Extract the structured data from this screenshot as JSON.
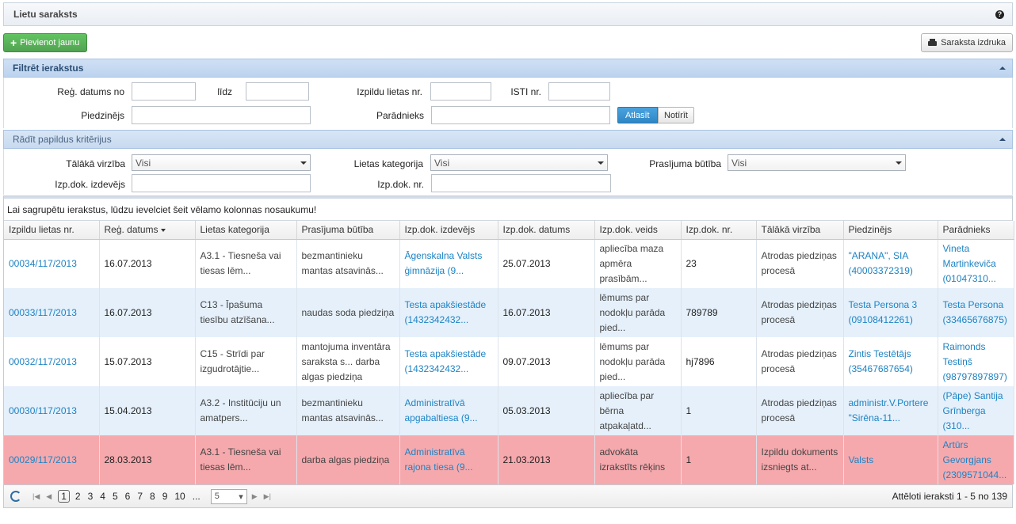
{
  "header": {
    "title": "Lietu saraksts",
    "help_icon": "?"
  },
  "toolbar": {
    "add_label": "Pievienot jaunu",
    "print_label": "Saraksta izdruka"
  },
  "filter": {
    "title": "Filtrēt ierakstus",
    "reg_from_label": "Reģ. datums no",
    "reg_to_label": "līdz",
    "case_no_label": "Izpildu lietas nr.",
    "isti_label": "ISTI nr.",
    "claimant_label": "Piedzinējs",
    "debtor_label": "Parādnieks",
    "search_label": "Atlasīt",
    "clear_label": "Notīrīt"
  },
  "extra": {
    "title": "Rādīt papildus kritērijus",
    "direction_label": "Tālākā virzība",
    "direction_value": "Visi",
    "category_label": "Lietas kategorija",
    "category_value": "Visi",
    "claim_label": "Prasījuma būtība",
    "claim_value": "Visi",
    "issuer_label": "Izp.dok. izdevējs",
    "docno_label": "Izp.dok. nr."
  },
  "grid": {
    "group_hint": "Lai sagrupētu ierakstus, lūdzu ievelciet šeit vēlamo kolonnas nosaukumu!",
    "columns": [
      "Izpildu lietas nr.",
      "Reģ. datums",
      "Lietas kategorija",
      "Prasījuma būtība",
      "Izp.dok. izdevējs",
      "Izp.dok. datums",
      "Izp.dok. veids",
      "Izp.dok. nr.",
      "Tālākā virzība",
      "Piedzinējs",
      "Parādnieks"
    ],
    "rows": [
      [
        "00034/117/2013",
        "16.07.2013",
        "A3.1 - Tiesneša vai tiesas lēm...",
        "bezmantinieku mantas atsavinās...",
        "Āgenskalna Valsts ģimnāzija (9...",
        "25.07.2013",
        "apliecība maza apmēra prasībām...",
        "23",
        "Atrodas piedziņas procesā",
        "\"ARANA\", SIA (40003372319)",
        "Vineta Martinkeviča (01047310..."
      ],
      [
        "00033/117/2013",
        "16.07.2013",
        "C13 - Īpašuma tiesību atzīšana...",
        "naudas soda piedziņa",
        "Testa apakšiestāde (1432342432...",
        "16.07.2013",
        "lēmums par nodokļu parāda pied...",
        "789789",
        "Atrodas piedziņas procesā",
        "Testa Persona 3 (09108412261)",
        "Testa Persona (33465676875)"
      ],
      [
        "00032/117/2013",
        "15.07.2013",
        "C15 - Strīdi par izgudrotājtie...",
        "mantojuma inventāra saraksta s... darba algas piedziņa",
        "Testa apakšiestāde (1432342432...",
        "09.07.2013",
        "lēmums par nodokļu parāda pied...",
        "hj7896",
        "Atrodas piedziņas procesā",
        "Zintis Testētājs (35467687654)",
        "Raimonds Testiņš (98797897897)"
      ],
      [
        "00030/117/2013",
        "15.04.2013",
        "A3.2 - Institūciju un amatpers...",
        "bezmantinieku mantas atsavinās...",
        "Administratīvā apgabaltiesa (9...",
        "05.03.2013",
        "apliecība par bērna atpakaļatd...",
        "1",
        "Atrodas piedziņas procesā",
        "administr.V.Portere \"Sirēna-11...",
        "(Pāpe) Santija Grīnberga (310..."
      ],
      [
        "00029/117/2013",
        "28.03.2013",
        "A3.1 - Tiesneša vai tiesas lēm...",
        "darba algas piedziņa",
        "Administratīvā rajona tiesa (9...",
        "21.03.2013",
        "advokāta izrakstīts rēķins",
        "1",
        "Izpildu dokuments izsniegts at...",
        "Valsts",
        "Artūrs Gevorgjans (2309571044..."
      ]
    ]
  },
  "pager": {
    "pages": [
      "1",
      "2",
      "3",
      "4",
      "5",
      "6",
      "7",
      "8",
      "9",
      "10",
      "..."
    ],
    "page_size": "5",
    "info": "Attēloti ieraksti 1 - 5 no 139"
  }
}
